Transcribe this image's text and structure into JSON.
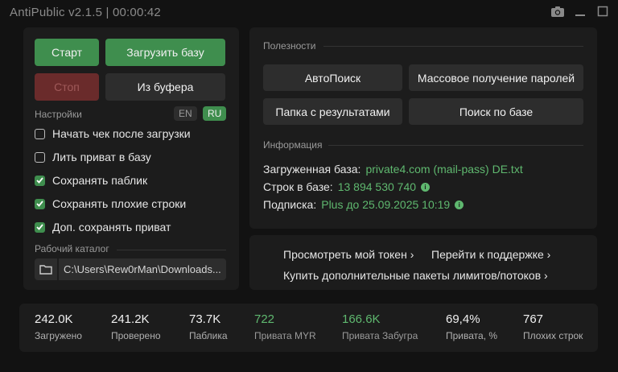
{
  "window": {
    "title": "AntiPublic v2.1.5 | 00:00:42"
  },
  "left": {
    "start_label": "Старт",
    "load_base_label": "Загрузить базу",
    "stop_label": "Стоп",
    "from_clipboard_label": "Из буфера",
    "settings_label": "Настройки",
    "lang_en": "EN",
    "lang_ru": "RU",
    "options": [
      {
        "label": "Начать чек после загрузки",
        "checked": false
      },
      {
        "label": "Лить приват в базу",
        "checked": false
      },
      {
        "label": "Сохранять паблик",
        "checked": true
      },
      {
        "label": "Сохранять плохие строки",
        "checked": true
      },
      {
        "label": "Доп. сохранять приват",
        "checked": true
      }
    ],
    "workdir_label": "Рабочий каталог",
    "workdir_value": "C:\\Users\\Rew0rMan\\Downloads..."
  },
  "utilities": {
    "label": "Полезности",
    "autosearch": "АвтоПоиск",
    "mass_passwords": "Массовое получение паролей",
    "results_folder": "Папка с результатами",
    "search_base": "Поиск по базе"
  },
  "info": {
    "label": "Информация",
    "loaded_base_label": "Загруженная база:",
    "loaded_base_value": "private4.com (mail-pass) DE.txt",
    "rows_label": "Строк в базе:",
    "rows_value": "13 894 530 740",
    "sub_label": "Подписка:",
    "sub_value": "Plus до 25.09.2025 10:19"
  },
  "links": {
    "view_token": "Просмотреть мой токен ›",
    "support": "Перейти к поддержке ›",
    "buy_limits": "Купить дополнительные пакеты лимитов/потоков ›"
  },
  "stats": [
    {
      "value": "242.0K",
      "label": "Загружено"
    },
    {
      "value": "241.2K",
      "label": "Проверено"
    },
    {
      "value": "73.7K",
      "label": "Паблика"
    },
    {
      "value": "722",
      "label": "Привата MYR"
    },
    {
      "value": "166.6K",
      "label": "Привата Забугра"
    },
    {
      "value": "69,4%",
      "label": "Привата, %"
    },
    {
      "value": "767",
      "label": "Плохих строк"
    }
  ],
  "colors": {
    "accent_green": "#3f8e4e",
    "value_green": "#5fb86f",
    "stop_red": "#6a2b2b"
  }
}
